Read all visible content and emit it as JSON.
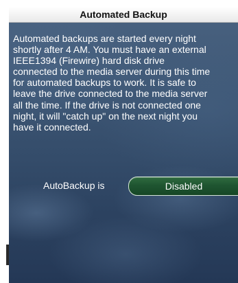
{
  "dialog": {
    "title": "Automated Backup",
    "description": "Automated backups are started every night\nshortly after 4 AM. You must have an external\nIEEE1394 (Firewire) hard disk drive\nconnected to the media server during this time\nfor automated backups to work. It is safe to\nleave the drive connected to the media server\nall the time. If the drive is not connected one\nnight, it will \"catch up\" on the next night you\nhave it connected."
  },
  "autobackup": {
    "label": "AutoBackup is",
    "state": "Disabled"
  },
  "colors": {
    "title_bar": "#f2f2f2",
    "panel_background": "#3d5674",
    "toggle_green": "#1f5531",
    "text": "#ffffff"
  }
}
